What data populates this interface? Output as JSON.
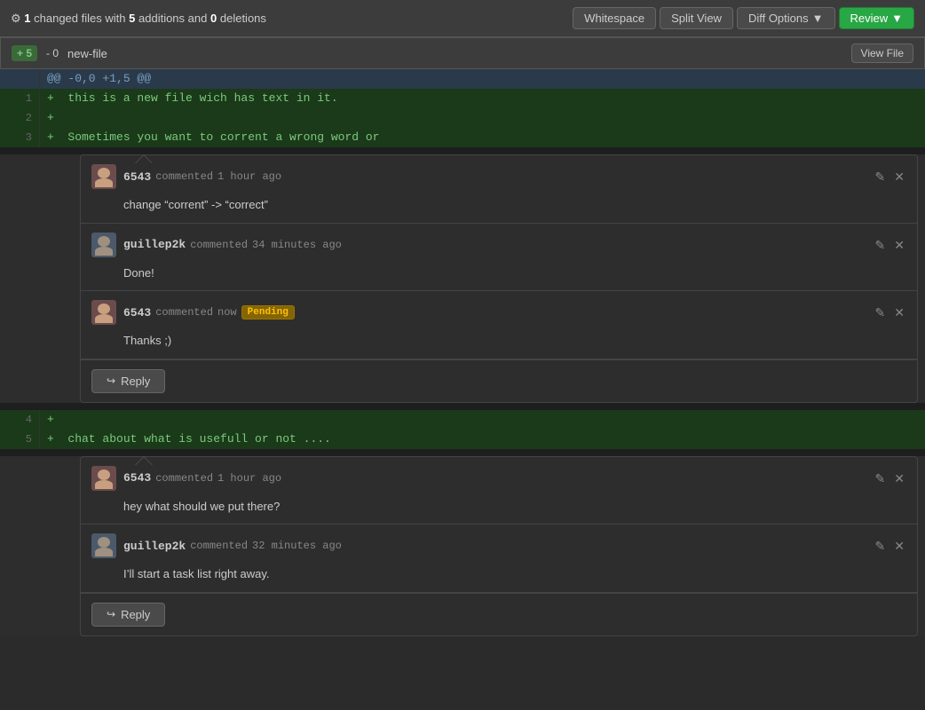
{
  "header": {
    "changed_files_count": "1",
    "additions": "5",
    "deletions": "0",
    "label": "changed files",
    "with_label": "with",
    "additions_label": "additions",
    "and_label": "and",
    "deletions_label": "deletions",
    "whitespace_btn": "Whitespace",
    "split_view_btn": "Split View",
    "diff_options_btn": "Diff Options",
    "review_btn": "Review"
  },
  "file": {
    "additions": "+ 5",
    "deletions": "- 0",
    "name": "new-file",
    "view_file_btn": "View File"
  },
  "diff": {
    "hunk_header": "@@ -0,0 +1,5 @@",
    "lines": [
      {
        "num": "1",
        "content": "+  this is a new file wich has text in it."
      },
      {
        "num": "2",
        "content": "+"
      },
      {
        "num": "3",
        "content": "+  Sometimes you want to corrent a wrong word or"
      },
      {
        "num": "4",
        "content": "+"
      },
      {
        "num": "5",
        "content": "+  chat about what is usefull or not ...."
      }
    ]
  },
  "thread1": {
    "comments": [
      {
        "author": "6543",
        "action": "commented",
        "time": "1 hour ago",
        "pending": false,
        "body": "change “corrent” -> “correct”"
      },
      {
        "author": "guillep2k",
        "action": "commented",
        "time": "34 minutes ago",
        "pending": false,
        "body": "Done!"
      },
      {
        "author": "6543",
        "action": "commented",
        "time": "now",
        "pending": true,
        "pending_label": "Pending",
        "body": "Thanks ;)"
      }
    ],
    "reply_btn": "Reply"
  },
  "thread2": {
    "comments": [
      {
        "author": "6543",
        "action": "commented",
        "time": "1 hour ago",
        "pending": false,
        "body": "hey what should we put there?"
      },
      {
        "author": "guillep2k",
        "action": "commented",
        "time": "32 minutes ago",
        "pending": false,
        "body": "I’ll start a task list right away."
      }
    ],
    "reply_btn": "Reply"
  }
}
